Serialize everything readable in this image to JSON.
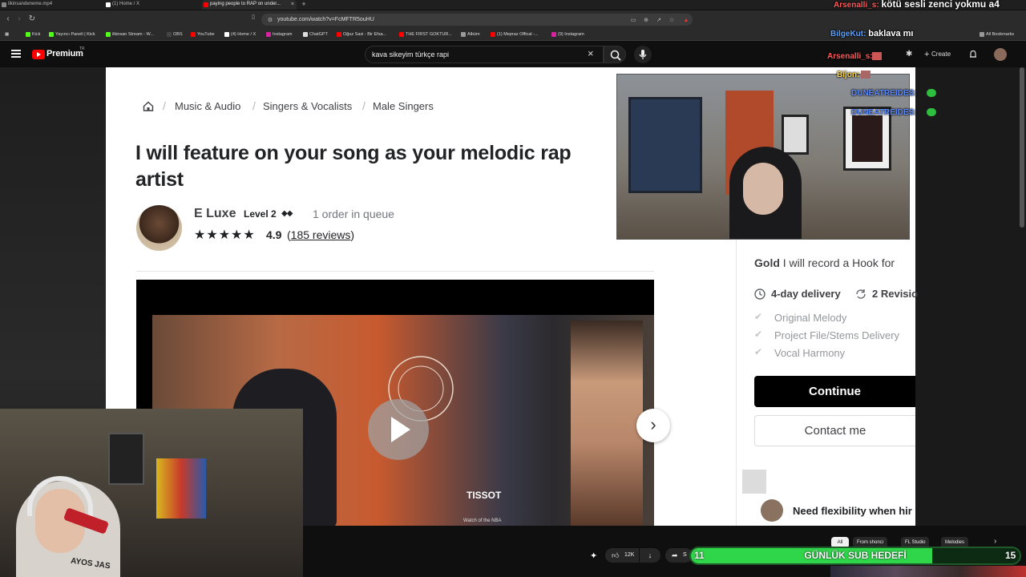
{
  "browser": {
    "tabs": [
      {
        "label": "ilkinsandeneme.mp4",
        "active": false
      },
      {
        "label": "(1) Home / X",
        "active": false
      },
      {
        "label": "paying people to RAP on under...",
        "active": true
      }
    ],
    "new_tab": "+",
    "url": "youtube.com/watch?v=FcMFTR5ouHU",
    "bookmarks": [
      "Kick",
      "Yayıncı Paneli | Kick",
      "ilkinsan Stream - W...",
      "OBS",
      "YouTube",
      "(4) Home / X",
      "Instagram",
      "ChatGPT",
      "Oğuz Sasi - Bir Efsa...",
      "THE FIRST GOKTUR...",
      "Albüm",
      "(1) Mepraz Offical -...",
      "(9) Instagram"
    ],
    "all_bookmarks": "All Bookmarks"
  },
  "youtube": {
    "logo_text": "Premium",
    "logo_tm": "TR",
    "search_value": "kava sikeyim türkçe rapi",
    "create_label": "Create",
    "like_count": "12K",
    "share_label": "S",
    "chips": [
      "All",
      "From shonci",
      "FL Studio",
      "Melodies"
    ]
  },
  "fiverr": {
    "breadcrumb": [
      "Music & Audio",
      "Singers & Vocalists",
      "Male Singers"
    ],
    "breadcrumb_sep": "/",
    "title": "I will feature on your song as your melodic rap artist",
    "seller_name": "E Luxe",
    "seller_level": "Level 2",
    "seller_level_diamonds": "◆◆",
    "queue": "1 order in queue",
    "stars": "★★★★★",
    "rating": "4.9",
    "reviews_open": "(",
    "reviews": "185 reviews",
    "reviews_close": ")",
    "video_brand": "TISSOT",
    "video_caption": "Watch of the NBA",
    "package_name": "Gold",
    "package_desc": "I will record a Hook for",
    "delivery": "4-day delivery",
    "revisions": "2 Revisio",
    "included": [
      "Original Melody",
      "Project File/Stems Delivery",
      "Vocal Harmony"
    ],
    "continue_label": "Continue",
    "contact_label": "Contact me",
    "flex_label": "Need flexibility when hir"
  },
  "chat": [
    {
      "user": "Arsenalli_s:",
      "msg": "kötü sesli zenci yokmu a4",
      "color": "#ff5a5a"
    },
    {
      "user": "BilgeKut:",
      "msg": "baklava mı",
      "color": "#5aa0ff"
    },
    {
      "user": "Arsenalli_s:",
      "msg": "",
      "color": "#ff5a5a"
    },
    {
      "user": "Bijon:",
      "msg": "",
      "color": "#ffd84a"
    },
    {
      "user": "DUNEATREIDES:",
      "msg": "",
      "color": "#5a8aff"
    },
    {
      "user": "DUNEATREIDES:",
      "msg": "",
      "color": "#5a8aff"
    }
  ],
  "facecam_text": "AYOS JAS",
  "sub_goal": {
    "title": "GÜNLÜK SUB HEDEFİ",
    "current": "11",
    "target": "15",
    "progress": 0.733,
    "color": "#2fd64a"
  },
  "icons": [
    "home-icon",
    "search-icon",
    "mic-icon",
    "close-icon",
    "bell-icon",
    "menu-icon",
    "play-icon",
    "chevron-right-icon",
    "clock-icon",
    "refresh-icon",
    "check-icon",
    "like-icon",
    "dislike-icon",
    "share-icon"
  ]
}
